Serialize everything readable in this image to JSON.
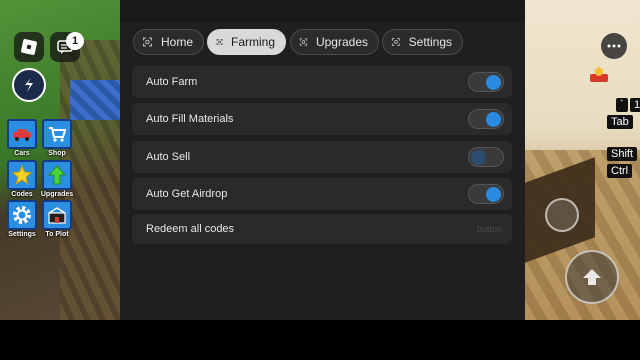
{
  "hud": {
    "notification_count": "1",
    "buttons": [
      {
        "label": "Cars"
      },
      {
        "label": "Shop"
      },
      {
        "label": "Codes"
      },
      {
        "label": "Upgrades"
      },
      {
        "label": "Settings"
      },
      {
        "label": "To Plot"
      }
    ]
  },
  "tabs": [
    {
      "label": "Home",
      "active": false
    },
    {
      "label": "Farming",
      "active": true
    },
    {
      "label": "Upgrades",
      "active": false
    },
    {
      "label": "Settings",
      "active": false
    }
  ],
  "options": [
    {
      "label": "Auto Farm",
      "type": "toggle",
      "enabled": true
    },
    {
      "label": "Auto Fill Materials",
      "type": "toggle",
      "enabled": true
    },
    {
      "label": "Auto Sell",
      "type": "toggle",
      "enabled": false
    },
    {
      "label": "Auto Get Airdrop",
      "type": "toggle",
      "enabled": true
    },
    {
      "label": "Redeem all codes",
      "type": "button",
      "hint": "button"
    }
  ],
  "keys": {
    "backtick": "`",
    "one": "1",
    "tab": "Tab",
    "shift": "Shift",
    "ctrl": "Ctrl"
  },
  "colors": {
    "accent": "#2a8ae0",
    "panel": "#1f1f21",
    "row": "#2a2a2c"
  }
}
